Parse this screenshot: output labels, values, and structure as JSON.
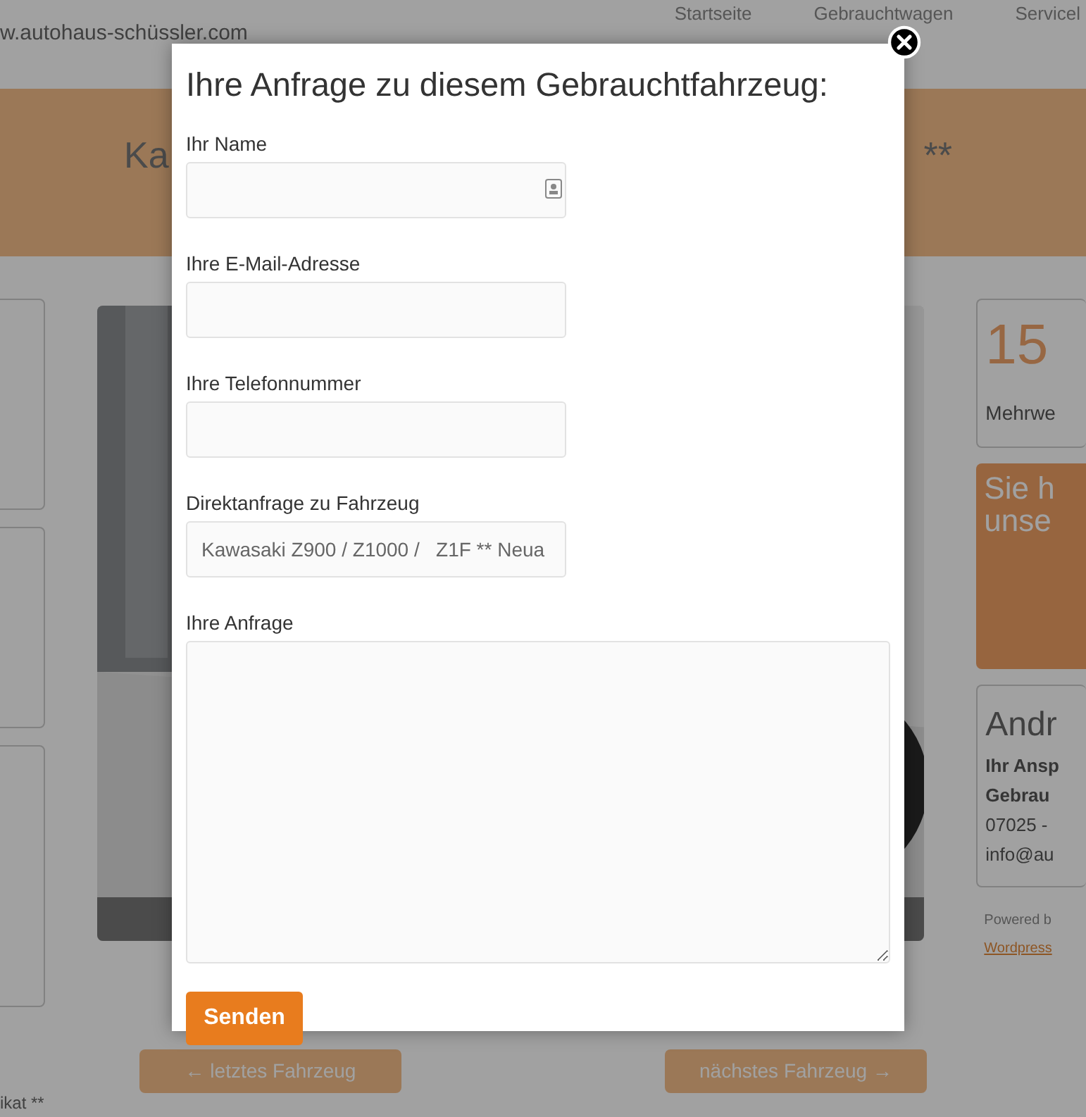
{
  "header": {
    "logo_text": "w.autohaus-schüssler.com",
    "nav": [
      "Startseite",
      "Gebrauchtwagen",
      "Servicel"
    ]
  },
  "banner": {
    "title_start": "Ka",
    "title_end": "**"
  },
  "vehicle_image": {
    "kind": "picture"
  },
  "sidebar": {
    "price": "15",
    "price_note": "Mehrwe",
    "promo_lines": [
      "Sie h",
      "unse"
    ],
    "contact": {
      "name": "Andr",
      "lines": [
        "Ihr Ansp",
        "Gebrau",
        "07025 -",
        "info@au"
      ]
    },
    "powered": "Powered b",
    "powered_link": "Wordpress"
  },
  "pager": [
    "← letztes Fahrzeug",
    "nächstes Fahrzeug →"
  ],
  "footnote": "ikat **",
  "modal": {
    "title": "Ihre Anfrage zu diesem Gebrauchtfahrzeug:",
    "fields": [
      {
        "label": "Ihr Name",
        "kind": "input",
        "autofill_icon": true
      },
      {
        "label": "Ihre E-Mail-Adresse",
        "kind": "input"
      },
      {
        "label": "Ihre Telefonnummer",
        "kind": "input"
      },
      {
        "label": "Direktanfrage zu Fahrzeug",
        "kind": "input",
        "value": "Kawasaki Z900 / Z1000 /   Z1F ** Neua"
      },
      {
        "label": "Ihre Anfrage",
        "kind": "textarea"
      }
    ],
    "submit": "Senden"
  }
}
